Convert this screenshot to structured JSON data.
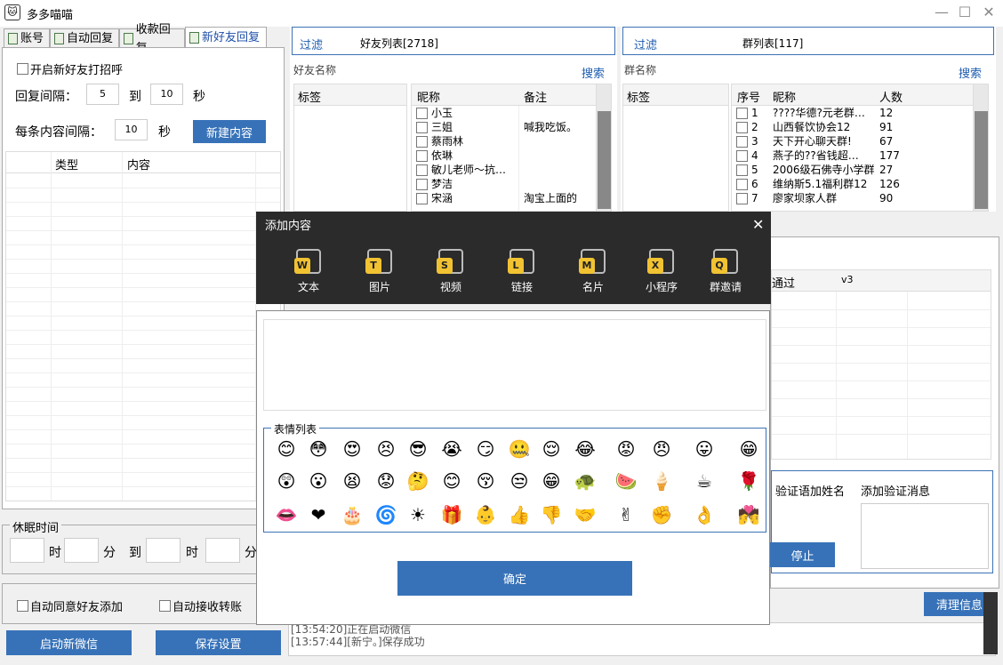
{
  "window": {
    "title": "多多喵喵",
    "min_label": "—",
    "max_label": "☐",
    "close_label": "✕"
  },
  "tabs": [
    {
      "label": "账号"
    },
    {
      "label": "自动回复"
    },
    {
      "label": "收款回复"
    },
    {
      "label": "新好友回复"
    }
  ],
  "new_friend": {
    "greet_label": "开启新好友打招呼",
    "interval_label": "回复间隔：",
    "interval_from": "5",
    "to_label": "到",
    "interval_to": "10",
    "sec_label": "秒",
    "each_label": "每条内容间隔：",
    "each_value": "10",
    "each_sec": "秒",
    "new_content_button": "新建内容",
    "col_type": "类型",
    "col_content": "内容"
  },
  "sleep": {
    "legend": "休眠时间",
    "hour": "时",
    "minute": "分",
    "to": "到",
    "hour2": "时",
    "minute2": "分"
  },
  "options": {
    "auto_accept": "自动同意好友添加",
    "auto_receive": "自动接收转账"
  },
  "bottom_buttons": {
    "start_wechat": "启动新微信",
    "save_settings": "保存设置"
  },
  "friends": {
    "filter": "过滤",
    "title": "好友列表[2718]",
    "name_label": "好友名称",
    "search": "搜索",
    "tag_col": "标签",
    "nick_col": "昵称",
    "remark_col": "备注",
    "rows": [
      {
        "nick": "小玉",
        "remark": ""
      },
      {
        "nick": "三姐",
        "remark": "喊我吃饭。"
      },
      {
        "nick": "蔡雨林",
        "remark": ""
      },
      {
        "nick": "依琳",
        "remark": ""
      },
      {
        "nick": "敏儿老师～抗…",
        "remark": ""
      },
      {
        "nick": "梦洁",
        "remark": ""
      },
      {
        "nick": "宋涵",
        "remark": "淘宝上面的"
      }
    ]
  },
  "groups": {
    "filter": "过滤",
    "title": "群列表[117]",
    "name_label": "群名称",
    "search": "搜索",
    "tag_col": "标签",
    "no_col": "序号",
    "nick_col": "昵称",
    "count_col": "人数",
    "rows": [
      {
        "no": "1",
        "name": "????华德?元老群…",
        "count": "12"
      },
      {
        "no": "2",
        "name": "山西餐饮协会12",
        "count": "91"
      },
      {
        "no": "3",
        "name": "天下开心聊天群!",
        "count": "67"
      },
      {
        "no": "4",
        "name": "燕子的??省钱超…",
        "count": "177"
      },
      {
        "no": "5",
        "name": "2006级石佛寺小学群",
        "count": "27"
      },
      {
        "no": "6",
        "name": "维纳斯5.1福利群12",
        "count": "126"
      },
      {
        "no": "7",
        "name": "廖家坝家人群",
        "count": "90"
      }
    ]
  },
  "verify": {
    "col_pass": "通过",
    "col_v3": "v3",
    "add_name": "验证语加姓名",
    "add_msg": "添加验证消息",
    "stop": "停止",
    "clear": "清理信息"
  },
  "log": [
    "[13:54:20]正在启动微信",
    "[13:57:44][新宁。]保存成功"
  ],
  "dialog": {
    "title": "添加内容",
    "close": "✕",
    "tools": [
      {
        "key": "W",
        "label": "文本"
      },
      {
        "key": "T",
        "label": "图片"
      },
      {
        "key": "S",
        "label": "视频"
      },
      {
        "key": "L",
        "label": "链接"
      },
      {
        "key": "M",
        "label": "名片"
      },
      {
        "key": "X",
        "label": "小程序"
      },
      {
        "key": "Q",
        "label": "群邀请"
      }
    ],
    "emoji_legend": "表情列表",
    "emojis": [
      "😊",
      "😳",
      "😍",
      "😣",
      "😎",
      "😭",
      "😏",
      "🤐",
      "😌",
      "😂",
      "😡",
      "😠",
      "😛",
      "😁",
      "😲",
      "😮",
      "😫",
      "😟",
      "🤔",
      "😊",
      "😚",
      "😒",
      "😁",
      "🐢",
      "🍉",
      "🍦",
      "☕",
      "🌹",
      "👄",
      "❤",
      "🎂",
      "🌀",
      "☀",
      "🎁",
      "👶",
      "👍",
      "👎",
      "🤝",
      "✌",
      "✊",
      "👌",
      "💏"
    ],
    "confirm": "确定"
  }
}
